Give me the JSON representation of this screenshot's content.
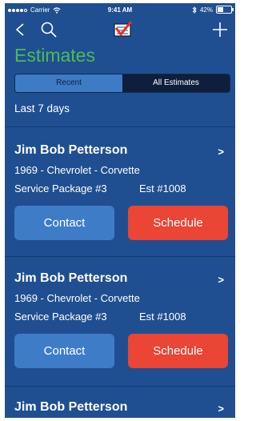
{
  "status_bar": {
    "carrier": "Carrier",
    "time": "9:41 AM",
    "battery": "42%",
    "battery_level": 0.42
  },
  "nav": {
    "back_icon": "chevron-left-icon",
    "search_icon": "search-icon",
    "logo_icon": "checklist-logo-icon",
    "add_icon": "plus-icon"
  },
  "page": {
    "title": "Estimates",
    "title_color": "#4dbb54"
  },
  "segment": {
    "options": [
      "Recent",
      "All Estimates"
    ],
    "selected": "Recent"
  },
  "filter": {
    "period": "Last 7 days"
  },
  "estimates": [
    {
      "customer": "Jim Bob Petterson",
      "vehicle": "1969 - Chevrolet - Corvette",
      "package": "Service Package #3",
      "estimate_no": "Est #1008",
      "contact_label": "Contact",
      "schedule_label": "Schedule"
    },
    {
      "customer": "Jim Bob Petterson",
      "vehicle": "1969 - Chevrolet - Corvette",
      "package": "Service Package #3",
      "estimate_no": "Est #1008",
      "contact_label": "Contact",
      "schedule_label": "Schedule"
    },
    {
      "customer": "Jim Bob Petterson"
    }
  ],
  "chevron": ">",
  "colors": {
    "background": "#1f4f91",
    "contact_button": "#3e7cc8",
    "schedule_button": "#ea4535",
    "segment_active": "#3d7bc4",
    "segment_inactive": "#0d1f3c"
  }
}
